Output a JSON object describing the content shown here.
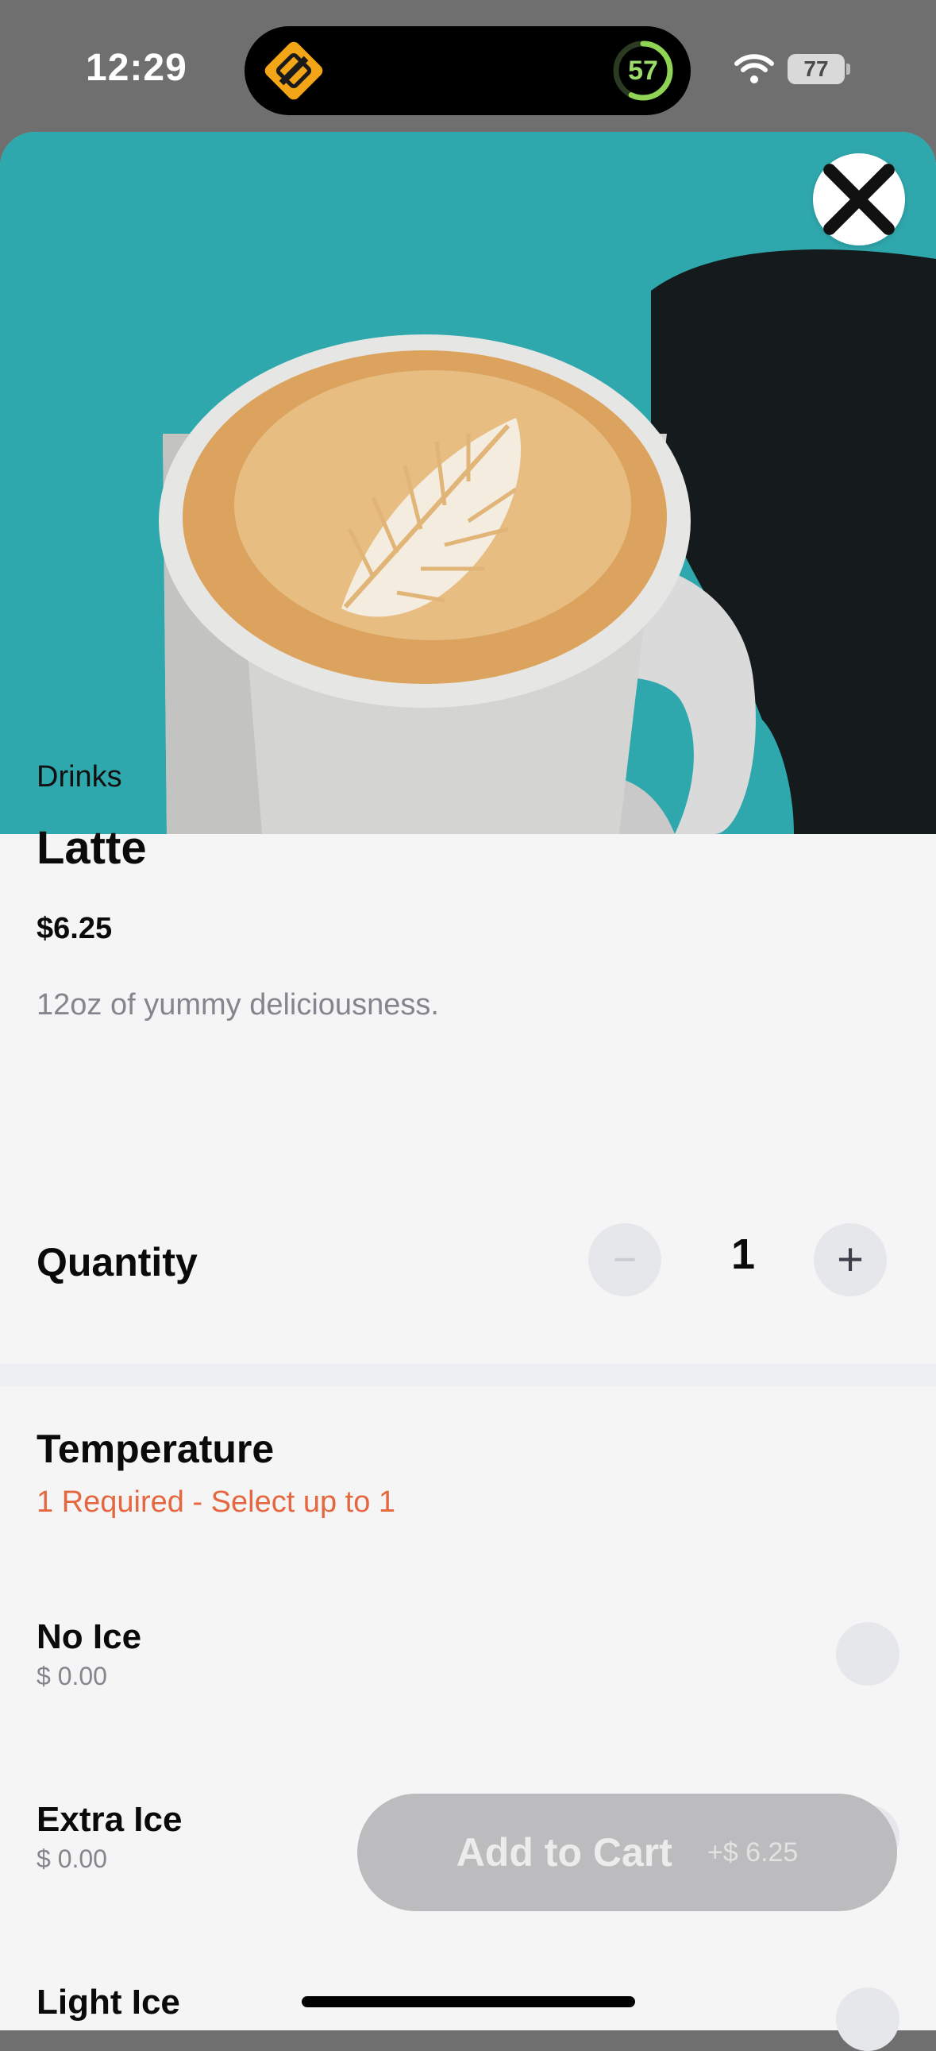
{
  "status_bar": {
    "time": "12:29",
    "activity_value": "57",
    "battery_level": "77"
  },
  "product": {
    "category": "Drinks",
    "name": "Latte",
    "price": "$6.25",
    "description": "12oz of yummy deliciousness."
  },
  "quantity": {
    "label": "Quantity",
    "value": "1",
    "minus_symbol": "−",
    "plus_symbol": "+"
  },
  "temperature": {
    "title": "Temperature",
    "requirement": "1 Required - Select up to 1",
    "options": [
      {
        "name": "No Ice",
        "price": "$ 0.00"
      },
      {
        "name": "Extra Ice",
        "price": "$ 0.00"
      },
      {
        "name": "Light Ice",
        "price": ""
      }
    ]
  },
  "cart": {
    "label": "Add to Cart",
    "price": "+$ 6.25"
  },
  "colors": {
    "accent_orange": "#e5673f",
    "hero_teal": "#2fa8ad",
    "button_disabled": "#bcbcbe"
  },
  "icons": {
    "close": "close-icon",
    "logo": "app-logo-icon",
    "wifi": "wifi-icon",
    "battery": "battery-icon"
  }
}
